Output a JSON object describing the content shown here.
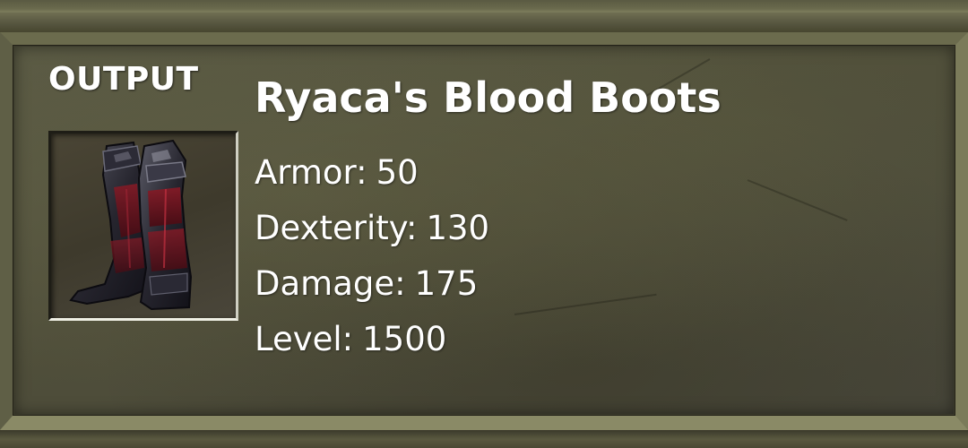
{
  "panel": {
    "output_label": "OUTPUT",
    "item": {
      "name": "Ryaca's Blood Boots",
      "icon": "blood-boots-icon",
      "stats": [
        {
          "label": "Armor:",
          "value": "50"
        },
        {
          "label": "Dexterity:",
          "value": "130"
        },
        {
          "label": "Damage:",
          "value": "175"
        },
        {
          "label": "Level:",
          "value": "1500"
        }
      ]
    }
  },
  "colors": {
    "background": "#4f4e3a",
    "frame": "#7b7b5a",
    "text": "#ffffff",
    "boot_dark": "#1c1b22",
    "boot_accent": "#7a1420"
  }
}
